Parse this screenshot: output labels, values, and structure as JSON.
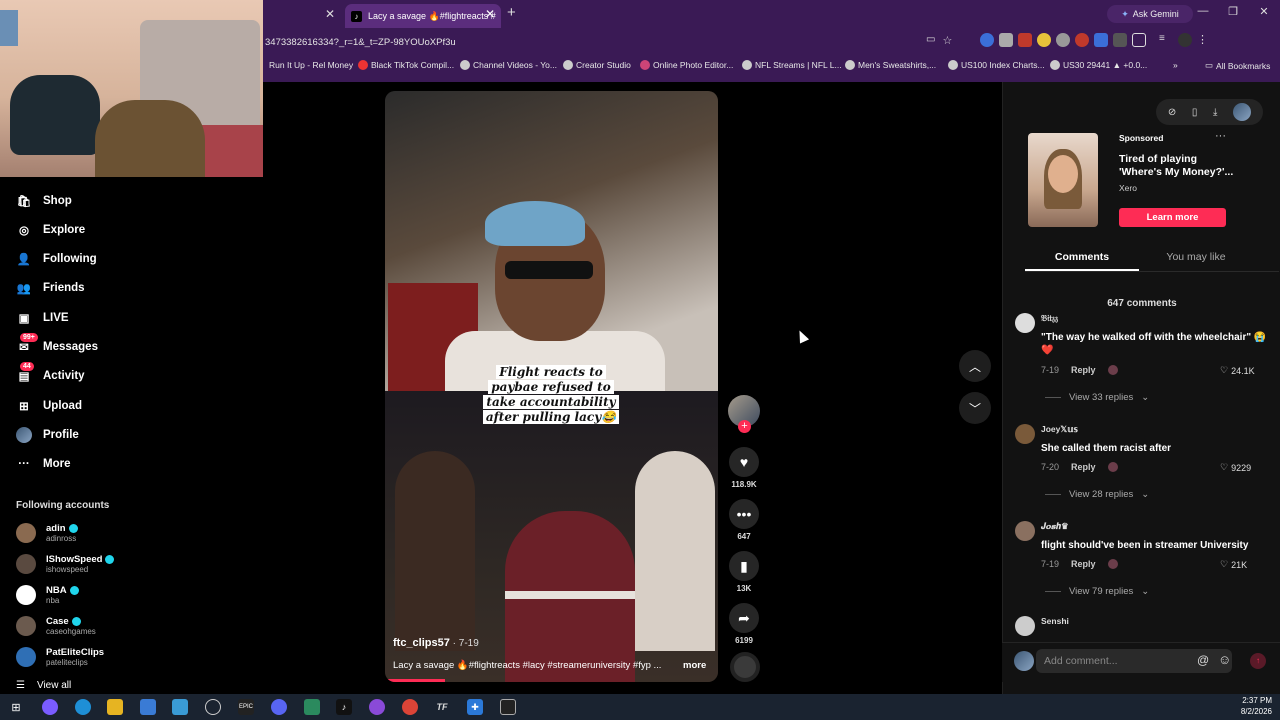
{
  "browser": {
    "tabs": [
      {
        "label": ""
      },
      {
        "label": "Lacy a savage 🔥#flightreacts #"
      }
    ],
    "new_tab": "+",
    "ask_gemini": "Ask Gemini",
    "url": "3473382616334?_r=1&_t=ZP-98YOUoXPf3u",
    "bookmarks": [
      "Run It Up - Rel Money",
      "Black TikTok Compil...",
      "Channel Videos - Yo...",
      "Creator Studio",
      "Online Photo Editor...",
      "NFL Streams | NFL L...",
      "Men's Sweatshirts,...",
      "US100 Index Charts...",
      "US30 29441 ▲ +0.0..."
    ],
    "bookmarks_overflow": "»",
    "all_bookmarks": "All Bookmarks"
  },
  "sidebar": {
    "nav": [
      {
        "label": "Shop",
        "icon": "shop-icon"
      },
      {
        "label": "Explore",
        "icon": "compass-icon"
      },
      {
        "label": "Following",
        "icon": "person-icon"
      },
      {
        "label": "Friends",
        "icon": "friends-icon"
      },
      {
        "label": "LIVE",
        "icon": "live-icon"
      },
      {
        "label": "Messages",
        "icon": "message-icon",
        "badge": "99+"
      },
      {
        "label": "Activity",
        "icon": "inbox-icon",
        "badge": "44"
      },
      {
        "label": "Upload",
        "icon": "upload-icon"
      },
      {
        "label": "Profile",
        "icon": "profile-icon"
      },
      {
        "label": "More",
        "icon": "more-icon"
      }
    ],
    "following_header": "Following accounts",
    "accounts": [
      {
        "name": "adin",
        "handle": "adinross",
        "verified": true
      },
      {
        "name": "IShowSpeed",
        "handle": "ishowspeed",
        "verified": true
      },
      {
        "name": "NBA",
        "handle": "nba",
        "verified": true
      },
      {
        "name": "Case",
        "handle": "caseohgames",
        "verified": true
      },
      {
        "name": "PatEliteClips",
        "handle": "pateliteclips",
        "verified": false
      }
    ],
    "view_all": "View all"
  },
  "video": {
    "caption": "Flight reacts to paybae refused to take accountability after pulling lacy😂",
    "author": "ftc_clips57",
    "date": " · 7-19",
    "description": "Lacy a savage 🔥#flightreacts #lacy #streameruniversity #fyp ...",
    "more": "more",
    "progress": 0.18
  },
  "actions": {
    "likes": "118.9K",
    "comments": "647",
    "saves": "13K",
    "shares": "6199"
  },
  "ad": {
    "sponsored": "Sponsored",
    "title": "Tired of playing 'Where's My Money?'...",
    "brand": "Xero",
    "cta": "Learn more"
  },
  "panel_tabs": {
    "comments": "Comments",
    "you_may_like": "You may like"
  },
  "comment_count": "647 comments",
  "comments": [
    {
      "user": "𝔅𝔦𝔱𝔷𝔷",
      "text": "\"The way he walked off with the wheelchair\" 😭❤️",
      "date": "7-19",
      "reply": "Reply",
      "likes": "24.1K",
      "replies": "View 33 replies"
    },
    {
      "user": "Joey𝕏𝕦𝕤",
      "text": "She called them racist after",
      "date": "7-20",
      "reply": "Reply",
      "likes": "9229",
      "replies": "View 28 replies"
    },
    {
      "user": "𝑱𝒐𝒔𝒉♛",
      "text": "flight should've been in streamer University",
      "date": "7-19",
      "reply": "Reply",
      "likes": "21K",
      "replies": "View 79 replies"
    },
    {
      "user": "Senshi",
      "text": "",
      "date": "",
      "reply": "",
      "likes": "",
      "replies": ""
    }
  ],
  "add_comment_placeholder": "Add comment...",
  "clock": {
    "time": "2:37 PM",
    "date": "8/2/2026"
  }
}
